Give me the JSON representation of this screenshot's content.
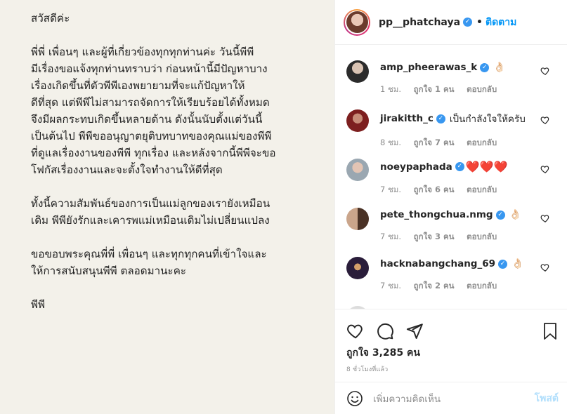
{
  "post": {
    "lines_p1": "สวัสดีค่ะ",
    "lines_p2": "พี่พี่ เพื่อนๆ และผู้ที่เกี่ยวข้องทุกทุกท่านค่ะ วันนี้พีพี\nมีเรื่องขอแจ้งทุกท่านทราบว่า ก่อนหน้านี้มีปัญหาบาง\nเรื่องเกิดขึ้นที่ตัวพีพีเองพยายามที่จะแก้ปัญหาให้\nดีที่สุด แต่พีพีไม่สามารถจัดการให้เรียบร้อยได้ทั้งหมด\nจึงมีผลกระทบเกิดขึ้นหลายด้าน ดังนั้นนับตั้งแต่วันนี้\nเป็นต้นไป พีพีขออนุญาตยุติบทบาทของคุณแม่ของพีพี\nที่ดูแลเรื่องงานของพีพี ทุกเรื่อง และหลังจากนี้พีพีจะขอ\nโฟกัสเรื่องงานและจะตั้งใจทำงานให้ดีที่สุด",
    "lines_p3": "ทั้งนี้ความสัมพันธ์ของการเป็นแม่ลูกของเรายังเหมือน\nเดิม พีพียังรักและเคารพแม่เหมือนเดิมไม่เปลี่ยนแปลง",
    "lines_p4": "ขอขอบพระคุณพี่พี่ เพื่อนๆ และทุกทุกคนที่เข้าใจและ\nให้การสนับสนุนพีพี ตลอดมานะคะ",
    "lines_p5": "พีพี"
  },
  "header": {
    "username": "pp__phatchaya",
    "separator": "•",
    "follow_label": "ติดตาม"
  },
  "comments": [
    {
      "username": "amp_pheerawas_k",
      "text": "",
      "emoji": "👌🏻",
      "time": "1 ชม.",
      "likes": "ถูกใจ 1 คน",
      "reply": "ตอบกลับ"
    },
    {
      "username": "jirakitth_c",
      "text": "เป็นกำลังใจให้ครับ",
      "emoji": "",
      "time": "8 ชม.",
      "likes": "ถูกใจ 7 คน",
      "reply": "ตอบกลับ"
    },
    {
      "username": "noeypaphada",
      "text": "",
      "emoji": "❤️❤️❤️",
      "time": "7 ชม.",
      "likes": "ถูกใจ 6 คน",
      "reply": "ตอบกลับ"
    },
    {
      "username": "pete_thongchua.nmg",
      "text": "",
      "emoji": "👌🏻",
      "time": "7 ชม.",
      "likes": "ถูกใจ 3 คน",
      "reply": "ตอบกลับ"
    },
    {
      "username": "hacknabangchang_69",
      "text": "",
      "emoji": "👌🏻",
      "time": "7 ชม.",
      "likes": "ถูกใจ 2 คน",
      "reply": "ตอบกลับ"
    }
  ],
  "footer": {
    "like_count": "ถูกใจ 3,285 คน",
    "timestamp": "8 ชั่วโมงที่แล้ว",
    "comment_placeholder": "เพิ่มความคิดเห็น",
    "post_label": "โพสต์"
  },
  "icons": {
    "like": "heart-outline-icon",
    "comment": "comment-bubble-icon",
    "share": "paper-plane-icon",
    "save": "bookmark-icon",
    "emoji": "smiley-icon",
    "verified": "verified-badge-icon"
  },
  "colors": {
    "accent": "#0095f6",
    "verified": "#3897f0",
    "muted": "#8e8e8e",
    "post_bg": "#f3f1ea",
    "post_button_disabled": "#b2dffc"
  }
}
